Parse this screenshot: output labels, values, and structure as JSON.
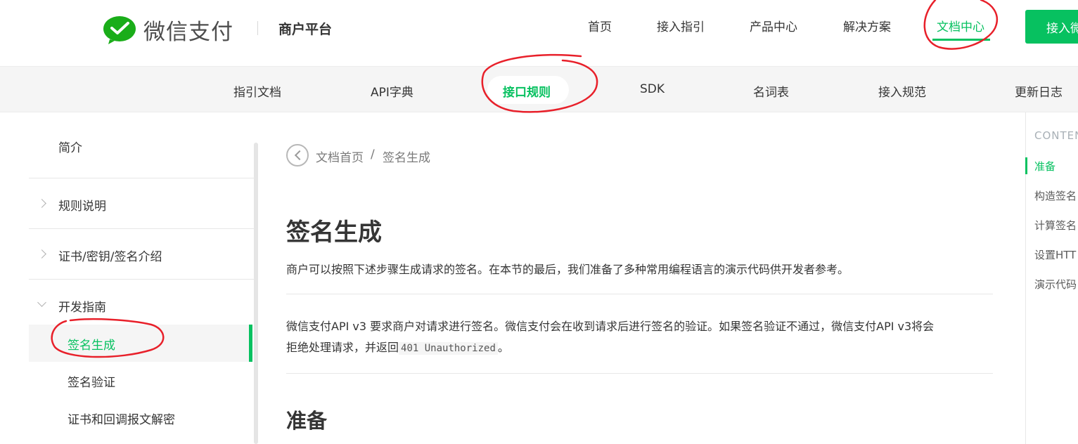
{
  "header": {
    "brand": "微信支付",
    "platform": "商户平台",
    "nav": [
      {
        "label": "首页",
        "active": false
      },
      {
        "label": "接入指引",
        "active": false
      },
      {
        "label": "产品中心",
        "active": false
      },
      {
        "label": "解决方案",
        "active": false
      },
      {
        "label": "文档中心",
        "active": true
      }
    ],
    "join_button": "接入微"
  },
  "subnav": {
    "items": [
      {
        "label": "指引文档",
        "active": false
      },
      {
        "label": "API字典",
        "active": false
      },
      {
        "label": "接口规则",
        "active": true
      },
      {
        "label": "SDK",
        "active": false
      },
      {
        "label": "名词表",
        "active": false
      },
      {
        "label": "接入规范",
        "active": false
      },
      {
        "label": "更新日志",
        "active": false
      }
    ]
  },
  "sidebar": {
    "items": [
      {
        "label": "简介"
      },
      {
        "label": "规则说明"
      },
      {
        "label": "证书/密钥/签名介绍"
      },
      {
        "label": "开发指南"
      },
      {
        "label": "签名生成"
      },
      {
        "label": "签名验证"
      },
      {
        "label": "证书和回调报文解密"
      }
    ]
  },
  "main": {
    "breadcrumb": {
      "home": "文档首页",
      "separator": "/",
      "current": "签名生成"
    },
    "title": "签名生成",
    "intro": "商户可以按照下述步骤生成请求的签名。在本节的最后，我们准备了多种常用编程语言的演示代码供开发者参考。",
    "para_line1": "微信支付API v3 要求商户对请求进行签名。微信支付会在收到请求后进行签名的验证。如果签名验证不通过，微信支付API v3将会",
    "para_line2_prefix": "拒绝处理请求，并返回",
    "para_line2_code": "401 Unauthorized",
    "para_line2_suffix": "。",
    "section_title": "准备"
  },
  "toc": {
    "title": "CONTEN",
    "items": [
      {
        "label": "准备",
        "active": true
      },
      {
        "label": "构造签名"
      },
      {
        "label": "计算签名"
      },
      {
        "label": "设置HTT"
      },
      {
        "label": "演示代码"
      }
    ]
  },
  "colors": {
    "accent": "#07c160",
    "annotation": "#e8202a"
  },
  "icons": {
    "logo": "wechat-pay-logo-icon",
    "back": "back-circle-icon",
    "collapsed": "chevron-right-icon",
    "expanded": "chevron-down-icon"
  }
}
